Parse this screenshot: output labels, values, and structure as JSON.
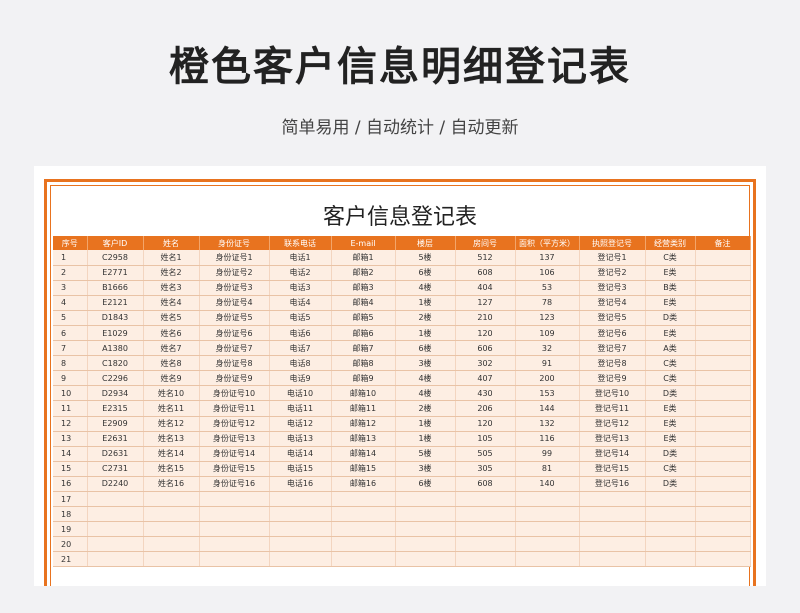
{
  "header": {
    "title": "橙色客户信息明细登记表",
    "subtitle": "简单易用  /  自动统计  /  自动更新"
  },
  "sheet": {
    "title": "客户信息登记表",
    "columns": [
      "序号",
      "客户ID",
      "姓名",
      "身份证号",
      "联系电话",
      "E-mail",
      "楼层",
      "房间号",
      "面积（平方米）",
      "执照登记号",
      "经营类别",
      "备注"
    ],
    "rows": [
      [
        "1",
        "C2958",
        "姓名1",
        "身份证号1",
        "电话1",
        "邮箱1",
        "5楼",
        "512",
        "137",
        "登记号1",
        "C类",
        ""
      ],
      [
        "2",
        "E2771",
        "姓名2",
        "身份证号2",
        "电话2",
        "邮箱2",
        "6楼",
        "608",
        "106",
        "登记号2",
        "E类",
        ""
      ],
      [
        "3",
        "B1666",
        "姓名3",
        "身份证号3",
        "电话3",
        "邮箱3",
        "4楼",
        "404",
        "53",
        "登记号3",
        "B类",
        ""
      ],
      [
        "4",
        "E2121",
        "姓名4",
        "身份证号4",
        "电话4",
        "邮箱4",
        "1楼",
        "127",
        "78",
        "登记号4",
        "E类",
        ""
      ],
      [
        "5",
        "D1843",
        "姓名5",
        "身份证号5",
        "电话5",
        "邮箱5",
        "2楼",
        "210",
        "123",
        "登记号5",
        "D类",
        ""
      ],
      [
        "6",
        "E1029",
        "姓名6",
        "身份证号6",
        "电话6",
        "邮箱6",
        "1楼",
        "120",
        "109",
        "登记号6",
        "E类",
        ""
      ],
      [
        "7",
        "A1380",
        "姓名7",
        "身份证号7",
        "电话7",
        "邮箱7",
        "6楼",
        "606",
        "32",
        "登记号7",
        "A类",
        ""
      ],
      [
        "8",
        "C1820",
        "姓名8",
        "身份证号8",
        "电话8",
        "邮箱8",
        "3楼",
        "302",
        "91",
        "登记号8",
        "C类",
        ""
      ],
      [
        "9",
        "C2296",
        "姓名9",
        "身份证号9",
        "电话9",
        "邮箱9",
        "4楼",
        "407",
        "200",
        "登记号9",
        "C类",
        ""
      ],
      [
        "10",
        "D2934",
        "姓名10",
        "身份证号10",
        "电话10",
        "邮箱10",
        "4楼",
        "430",
        "153",
        "登记号10",
        "D类",
        ""
      ],
      [
        "11",
        "E2315",
        "姓名11",
        "身份证号11",
        "电话11",
        "邮箱11",
        "2楼",
        "206",
        "144",
        "登记号11",
        "E类",
        ""
      ],
      [
        "12",
        "E2909",
        "姓名12",
        "身份证号12",
        "电话12",
        "邮箱12",
        "1楼",
        "120",
        "132",
        "登记号12",
        "E类",
        ""
      ],
      [
        "13",
        "E2631",
        "姓名13",
        "身份证号13",
        "电话13",
        "邮箱13",
        "1楼",
        "105",
        "116",
        "登记号13",
        "E类",
        ""
      ],
      [
        "14",
        "D2631",
        "姓名14",
        "身份证号14",
        "电话14",
        "邮箱14",
        "5楼",
        "505",
        "99",
        "登记号14",
        "D类",
        ""
      ],
      [
        "15",
        "C2731",
        "姓名15",
        "身份证号15",
        "电话15",
        "邮箱15",
        "3楼",
        "305",
        "81",
        "登记号15",
        "C类",
        ""
      ],
      [
        "16",
        "D2240",
        "姓名16",
        "身份证号16",
        "电话16",
        "邮箱16",
        "6楼",
        "608",
        "140",
        "登记号16",
        "D类",
        ""
      ],
      [
        "17",
        "",
        "",
        "",
        "",
        "",
        "",
        "",
        "",
        "",
        "",
        ""
      ],
      [
        "18",
        "",
        "",
        "",
        "",
        "",
        "",
        "",
        "",
        "",
        "",
        ""
      ],
      [
        "19",
        "",
        "",
        "",
        "",
        "",
        "",
        "",
        "",
        "",
        "",
        ""
      ],
      [
        "20",
        "",
        "",
        "",
        "",
        "",
        "",
        "",
        "",
        "",
        "",
        ""
      ],
      [
        "21",
        "",
        "",
        "",
        "",
        "",
        "",
        "",
        "",
        "",
        "",
        ""
      ]
    ]
  },
  "colors": {
    "accent": "#e8731f",
    "row_fill": "#fdeee3",
    "page_background": "#f2f2f4"
  }
}
